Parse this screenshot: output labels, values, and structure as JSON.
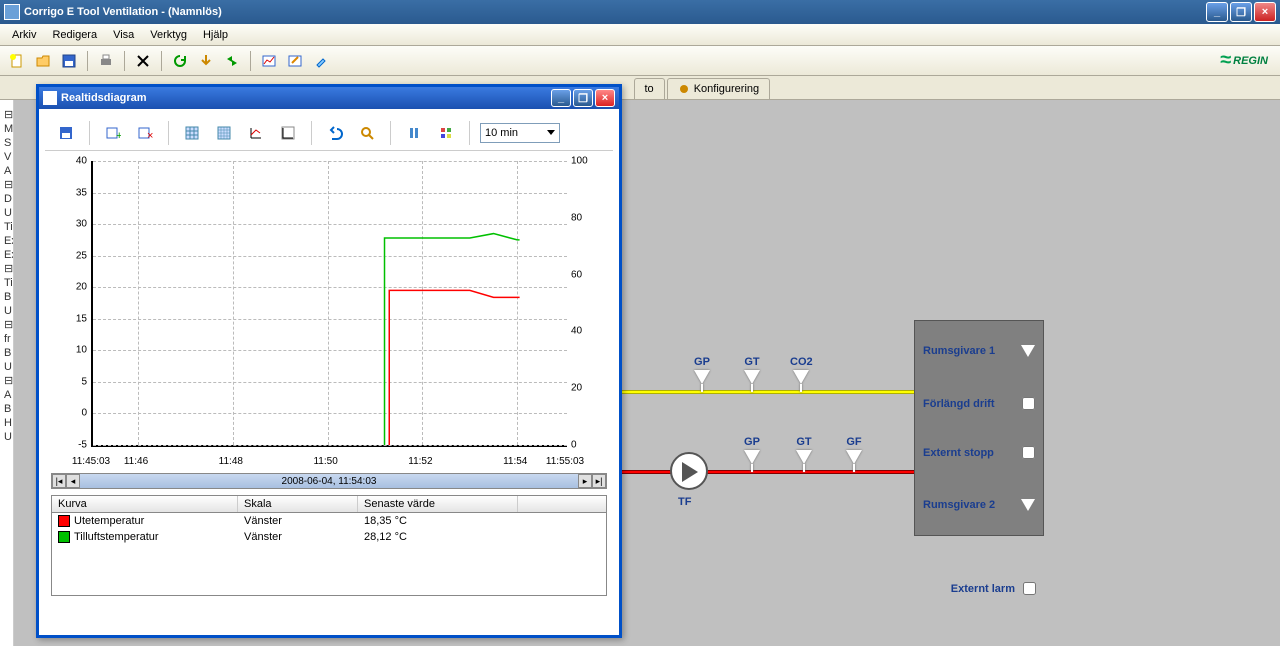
{
  "window": {
    "title": "Corrigo E Tool Ventilation - (Namnlös)",
    "min": "_",
    "max": "❐",
    "close": "×"
  },
  "menu": {
    "items": [
      "Arkiv",
      "Redigera",
      "Visa",
      "Verktyg",
      "Hjälp"
    ]
  },
  "logo": "REGIN",
  "tabs": {
    "right1": "to",
    "right2": "Konfigurering"
  },
  "tree_sliver": [
    "⊟ S",
    "M",
    "S",
    "V",
    "A",
    "⊟ G",
    "D",
    "U",
    "Ti",
    "Ex",
    "Ex",
    "⊟ T",
    "Ti",
    "B",
    "U",
    "⊟ F",
    "fr",
    "B",
    "U",
    "⊟ A",
    "A",
    "B",
    "H",
    "U"
  ],
  "dialog": {
    "title": "Realtidsdiagram",
    "min": "_",
    "max": "❐",
    "close": "×",
    "time_range": "10 min",
    "scroll_label": "2008-06-04, 11:54:03",
    "legend": {
      "hdr_kurva": "Kurva",
      "hdr_skala": "Skala",
      "hdr_varde": "Senaste värde",
      "rows": [
        {
          "color": "#ff0000",
          "name": "Utetemperatur",
          "skala": "Vänster",
          "varde": "18,35 °C"
        },
        {
          "color": "#00c000",
          "name": "Tilluftstemperatur",
          "skala": "Vänster",
          "varde": "28,12 °C"
        }
      ]
    }
  },
  "chart_data": {
    "type": "line",
    "xlabel": "",
    "ylabel_left": "",
    "ylabel_right": "",
    "x_ticks": [
      "11:45:03",
      "11:46",
      "11:48",
      "11:50",
      "11:52",
      "11:54",
      "11:55:03"
    ],
    "y_left_ticks": [
      -5,
      0,
      5,
      10,
      15,
      20,
      25,
      30,
      35,
      40
    ],
    "y_right_ticks": [
      0,
      20,
      40,
      60,
      80,
      100
    ],
    "y_left_range": [
      -5,
      40
    ],
    "y_right_range": [
      0,
      100
    ],
    "series": [
      {
        "name": "Utetemperatur",
        "color": "#ff0000",
        "axis": "left",
        "points": [
          {
            "x": "11:51:18",
            "y": -5
          },
          {
            "x": "11:51:18",
            "y": 19.5
          },
          {
            "x": "11:53:00",
            "y": 19.5
          },
          {
            "x": "11:53:30",
            "y": 18.4
          },
          {
            "x": "11:54:03",
            "y": 18.4
          }
        ]
      },
      {
        "name": "Tilluftstemperatur",
        "color": "#00c000",
        "axis": "left",
        "points": [
          {
            "x": "11:51:12",
            "y": -5
          },
          {
            "x": "11:51:12",
            "y": 27.8
          },
          {
            "x": "11:53:00",
            "y": 27.8
          },
          {
            "x": "11:53:30",
            "y": 28.5
          },
          {
            "x": "11:54:00",
            "y": 27.5
          },
          {
            "x": "11:54:03",
            "y": 27.5
          }
        ]
      }
    ]
  },
  "schematic": {
    "sensors_top": [
      "GP",
      "GT",
      "CO2"
    ],
    "sensors_bot": [
      "GP",
      "GT",
      "GF"
    ],
    "pump_label": "TF",
    "panel": {
      "rumsgivare1": "Rumsgivare 1",
      "forlangd": "Förlängd drift",
      "externt_stopp": "Externt stopp",
      "rumsgivare2": "Rumsgivare 2",
      "externt_larm": "Externt larm"
    }
  }
}
